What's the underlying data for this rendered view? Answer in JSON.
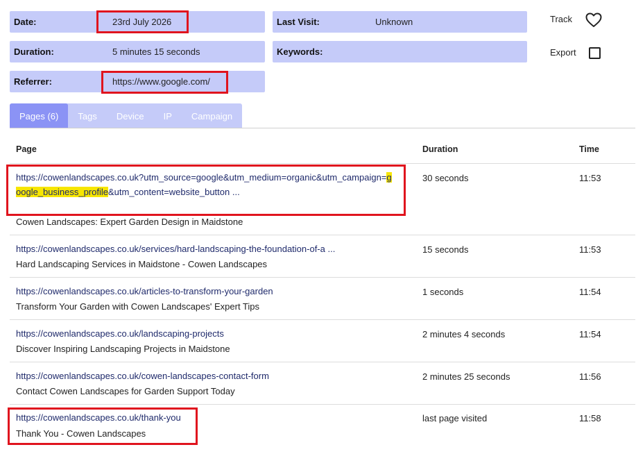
{
  "fields": {
    "date_label": "Date:",
    "date_value": "23rd July 2026",
    "duration_label": "Duration:",
    "duration_value": "5 minutes 15 seconds",
    "referrer_label": "Referrer:",
    "referrer_value": "https://www.google.com/",
    "last_visit_label": "Last Visit:",
    "last_visit_value": "Unknown",
    "keywords_label": "Keywords:",
    "keywords_value": ""
  },
  "actions": {
    "track_label": "Track",
    "export_label": "Export",
    "track_icon": "heart-icon",
    "export_icon": "checkbox"
  },
  "tabs": [
    {
      "label": "Pages (6)",
      "active": true
    },
    {
      "label": "Tags"
    },
    {
      "label": "Device"
    },
    {
      "label": "IP"
    },
    {
      "label": "Campaign"
    }
  ],
  "table": {
    "headers": {
      "page": "Page",
      "duration": "Duration",
      "time": "Time"
    },
    "rows": [
      {
        "url_part1": "https://cowenlandscapes.co.uk?utm_source=google&utm_medium=organic&utm_campaign=",
        "url_highlight": "google_business_profile",
        "url_part2": "&utm_content=website_button ...",
        "title": "Cowen Landscapes: Expert Garden Design in Maidstone",
        "duration": "30 seconds",
        "time": "11:53"
      },
      {
        "url": "https://cowenlandscapes.co.uk/services/hard-landscaping-the-foundation-of-a ...",
        "title": "Hard Landscaping Services in Maidstone - Cowen Landscapes",
        "duration": "15 seconds",
        "time": "11:53"
      },
      {
        "url": "https://cowenlandscapes.co.uk/articles-to-transform-your-garden",
        "title": "Transform Your Garden with Cowen Landscapes' Expert Tips",
        "duration": "1 seconds",
        "time": "11:54"
      },
      {
        "url": "https://cowenlandscapes.co.uk/landscaping-projects",
        "title": "Discover Inspiring Landscaping Projects in Maidstone",
        "duration": "2 minutes 4 seconds",
        "time": "11:54"
      },
      {
        "url": "https://cowenlandscapes.co.uk/cowen-landscapes-contact-form",
        "title": "Contact Cowen Landscapes for Garden Support Today",
        "duration": "2 minutes 25 seconds",
        "time": "11:56"
      },
      {
        "url": "https://cowenlandscapes.co.uk/thank-you",
        "title": "Thank You - Cowen Landscapes",
        "duration": "last page visited",
        "time": "11:58"
      }
    ]
  },
  "colors": {
    "field_bg": "#c5cbf9",
    "active_tab": "#8b93f5",
    "annotation_red": "#e0141e",
    "highlight_yellow": "#f7e600"
  }
}
